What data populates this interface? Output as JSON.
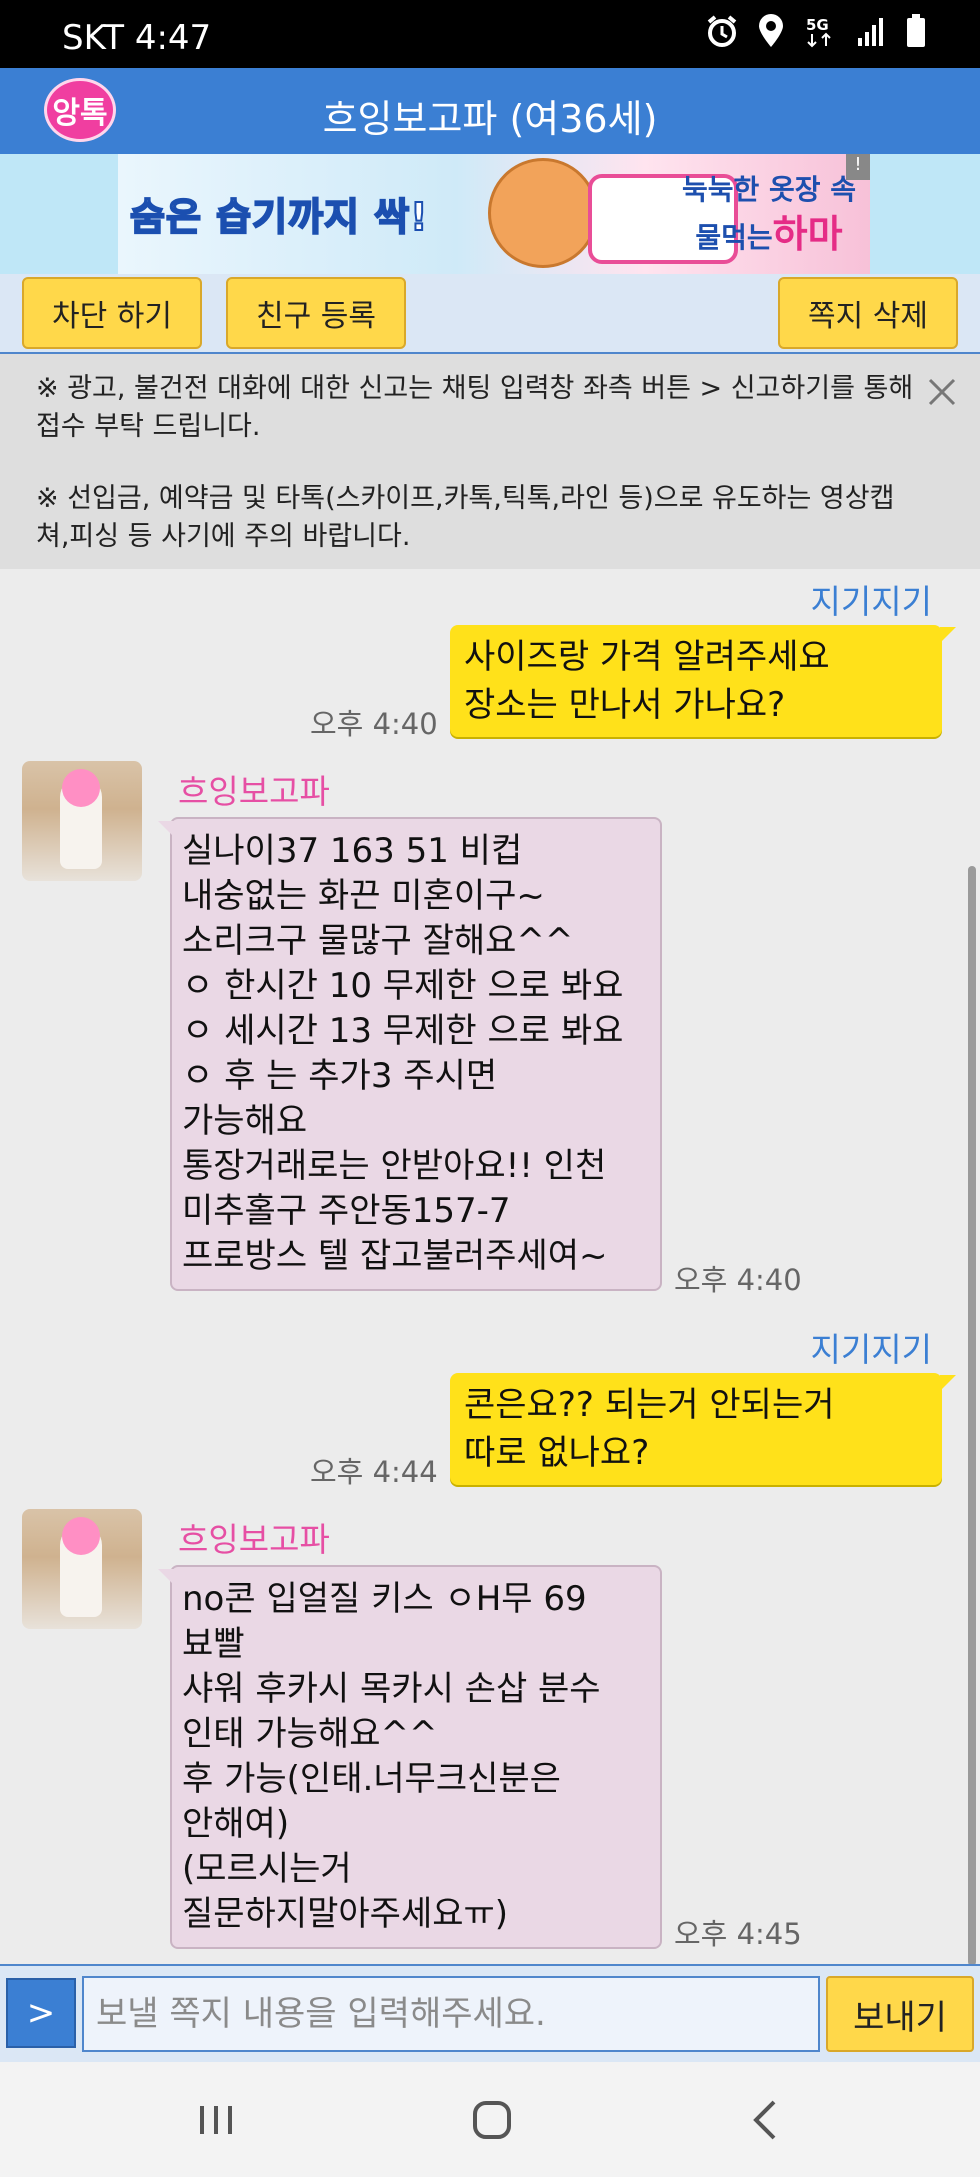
{
  "status_bar": {
    "carrier_time": "SKT 4:47",
    "icons": [
      "alarm-icon",
      "location-icon",
      "5g-icon",
      "signal-icon",
      "battery-icon"
    ]
  },
  "header": {
    "logo_text": "앙톡",
    "title": "흐잉보고파 (여36세)"
  },
  "ad": {
    "headline": "숨은 습기까지 싹!",
    "line1": "눅눅한 옷장 속",
    "line2_prefix": "물먹는",
    "line2_brand": "하마",
    "info_icon": "!"
  },
  "actions": {
    "block_label": "차단 하기",
    "add_friend_label": "친구 등록",
    "delete_label": "쪽지 삭제"
  },
  "notice": {
    "line1": "※ 광고, 불건전 대화에 대한 신고는 채팅 입력창 좌측 버튼 > 신고하기를 통해 접수 부탁 드립니다.",
    "line2": "※ 선입금, 예약금 및 타톡(스카이프,카톡,틱톡,라인 등)으로 유도하는 영상캡쳐,피싱 등 사기에 주의 바랍니다."
  },
  "messages": [
    {
      "from": "me",
      "sender": "지기지기",
      "lines": [
        "사이즈랑 가격 알려주세요",
        "장소는 만나서 가나요?"
      ],
      "time": "오후 4:40"
    },
    {
      "from": "other",
      "sender": "흐잉보고파",
      "lines": [
        "실나이37 163 51 비컵",
        "내숭없는 화끈 미혼이구~",
        "소리크구 물많구 잘해요^^",
        "ㅇ 한시간 10 무제한 으로 봐요",
        "ㅇ 세시간 13 무제한 으로 봐요",
        "ㅇ 후 는 추가3 주시면",
        "가능해요",
        "통장거래로는 안받아요!! 인천",
        "미추홀구 주안동157-7",
        "프로방스 텔 잡고불러주세여~"
      ],
      "time": "오후 4:40"
    },
    {
      "from": "me",
      "sender": "지기지기",
      "lines": [
        "콘은요?? 되는거 안되는거",
        "따로 없나요?"
      ],
      "time": "오후 4:44"
    },
    {
      "from": "other",
      "sender": "흐잉보고파",
      "lines": [
        "no콘 입얼질 키스 ㅇH무 69",
        "뵤빨",
        "샤워 후카시 목카시 손삽 분수",
        "인태  가능해요^^",
        "후 가능(인태.너무크신분은",
        "안해여)",
        "(모르시는거",
        "질문하지말아주세요ㅠ)"
      ],
      "time": "오후 4:45"
    }
  ],
  "input": {
    "menu_label": ">",
    "placeholder": "보낼 쪽지 내용을 입력해주세요.",
    "send_label": "보내기"
  },
  "nav": {
    "icons": [
      "recent-apps-icon",
      "home-icon",
      "back-icon"
    ]
  },
  "colors": {
    "header": "#3b7fd3",
    "my_bubble": "#ffe11a",
    "other_bubble": "#ead8e5",
    "button": "#ffd84a",
    "other_name": "#e64fa4"
  }
}
